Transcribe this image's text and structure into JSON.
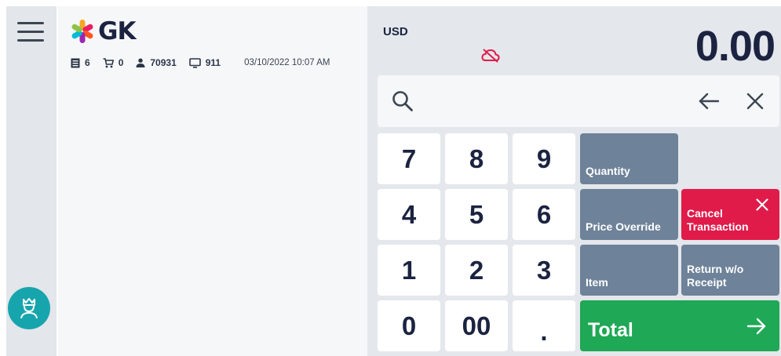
{
  "header": {
    "logo_text": "GK",
    "stats": [
      {
        "icon": "receipt-icon",
        "value": "6"
      },
      {
        "icon": "cart-icon",
        "value": "0"
      },
      {
        "icon": "user-icon",
        "value": "70931"
      },
      {
        "icon": "monitor-icon",
        "value": "911"
      }
    ],
    "datetime": "03/10/2022 10:07 AM"
  },
  "display": {
    "currency": "USD",
    "amount": "0.00",
    "offline_icon": "cloud-off-icon"
  },
  "search": {
    "value": "",
    "placeholder": ""
  },
  "keypad": {
    "k7": "7",
    "k8": "8",
    "k9": "9",
    "k4": "4",
    "k5": "5",
    "k6": "6",
    "k1": "1",
    "k2": "2",
    "k3": "3",
    "k0": "0",
    "k00": "00",
    "kdot": "."
  },
  "functions": {
    "quantity": "Quantity",
    "price_override": "Price Override",
    "item": "Item",
    "cancel_line1": "Cancel",
    "cancel_line2": "Transaction",
    "return_line1": "Return w/o",
    "return_line2": "Receipt",
    "total": "Total"
  },
  "colors": {
    "accent_teal": "#17a5ad",
    "function_gray": "#6e8299",
    "cancel_red": "#e01b4a",
    "total_green": "#1fa855",
    "text_dark": "#1b2340"
  }
}
